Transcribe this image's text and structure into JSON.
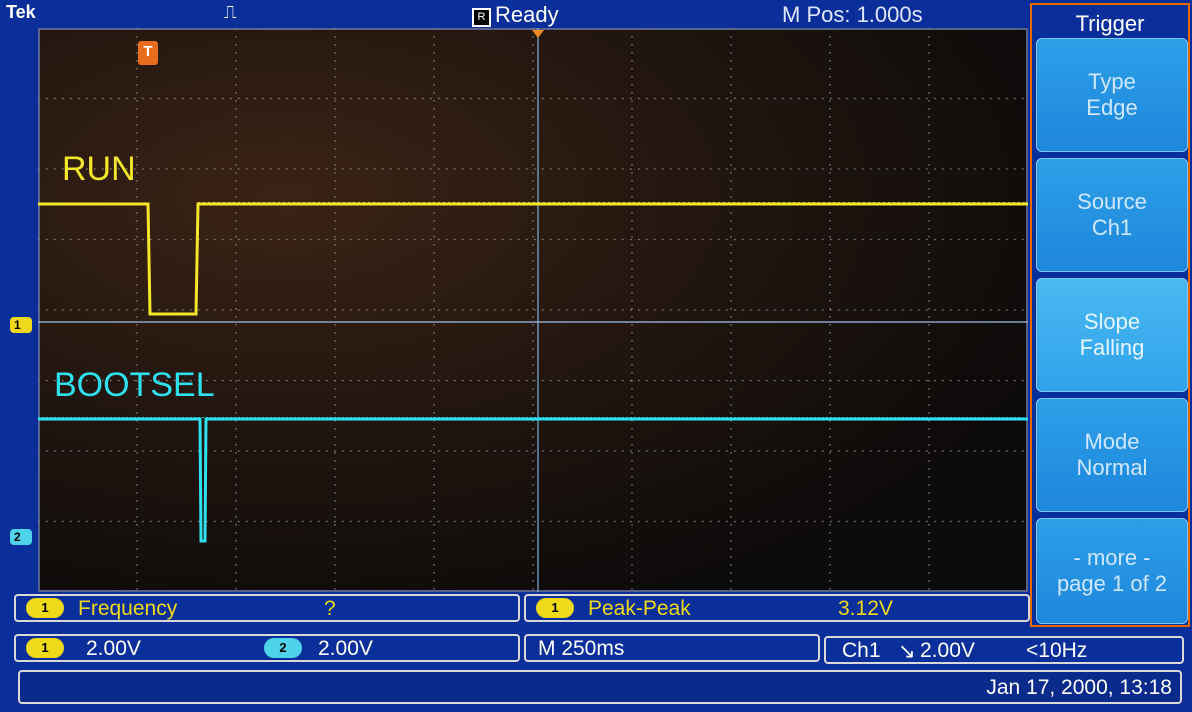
{
  "topbar": {
    "brand": "Tek",
    "acquisition_icon": "single-pulse-icon",
    "status_icon_letter": "R",
    "status": "Ready",
    "m_pos": "M Pos: 1.000s"
  },
  "traces": {
    "ch1_label": "RUN",
    "ch2_label": "BOOTSEL",
    "ch1_color": "#f4e62a",
    "ch2_color": "#2fe0f0"
  },
  "markers": {
    "ch1": "1",
    "ch2": "2",
    "trigger": "T"
  },
  "menu": {
    "title": "Trigger",
    "buttons": [
      {
        "line1": "Type",
        "line2": "Edge"
      },
      {
        "line1": "Source",
        "line2": "Ch1"
      },
      {
        "line1": "Slope",
        "line2": "Falling"
      },
      {
        "line1": "Mode",
        "line2": "Normal"
      },
      {
        "line1": "- more -",
        "line2": "page 1 of 2"
      }
    ]
  },
  "measurements": {
    "m1": {
      "channel": "1",
      "name": "Frequency",
      "value": "?"
    },
    "m2": {
      "channel": "1",
      "name": "Peak-Peak",
      "value": "3.12V"
    }
  },
  "settings": {
    "ch1_channel": "1",
    "ch1_scale": "2.00V",
    "ch2_channel": "2",
    "ch2_scale": "2.00V",
    "timebase": "M 250ms",
    "trigger_source": "Ch1",
    "trigger_slope_icon": "falling-edge-icon",
    "trigger_slope_glyph": "↘",
    "trigger_level": "2.00V",
    "trigger_freq": "<10Hz"
  },
  "footer": {
    "datetime": "Jan 17, 2000, 13:18"
  },
  "colors": {
    "background": "#0b2f9a",
    "menu_border": "#e66a00",
    "button": "#1e86dc"
  }
}
